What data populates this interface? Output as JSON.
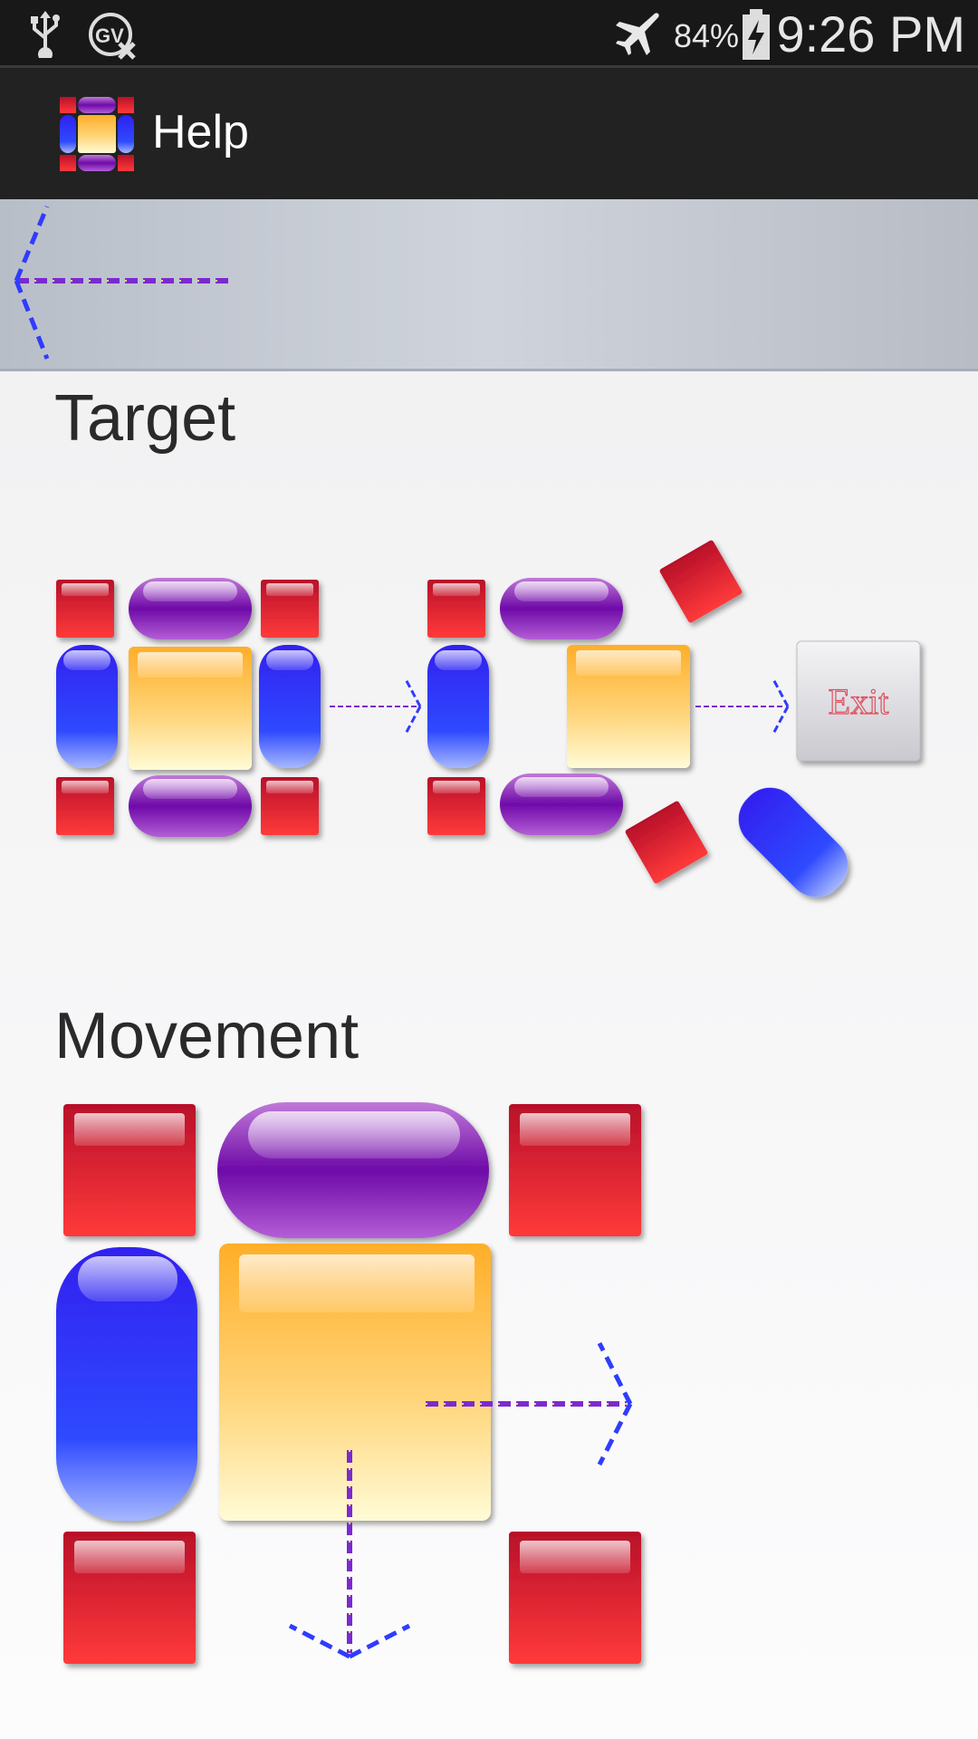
{
  "status_bar": {
    "time": "9:26 PM",
    "battery_percent": "84%",
    "icons": [
      "usb-icon",
      "gv-off-icon",
      "airplane-mode-icon",
      "battery-charging-icon"
    ]
  },
  "action_bar": {
    "title": "Help",
    "logo_icon": "app-logo-icon"
  },
  "back_banner": {
    "icon": "back-arrow-icon"
  },
  "sections": {
    "target": {
      "title": "Target"
    },
    "movement": {
      "title": "Movement"
    }
  },
  "target_figure": {
    "exit_label": "Exit"
  },
  "colors": {
    "red_block": "#e0303b",
    "purple_block": "#8a2bc2",
    "blue_block": "#2f3cff",
    "yellow_block": "#ffc040",
    "arrow_dash": "#7a2ad0"
  }
}
